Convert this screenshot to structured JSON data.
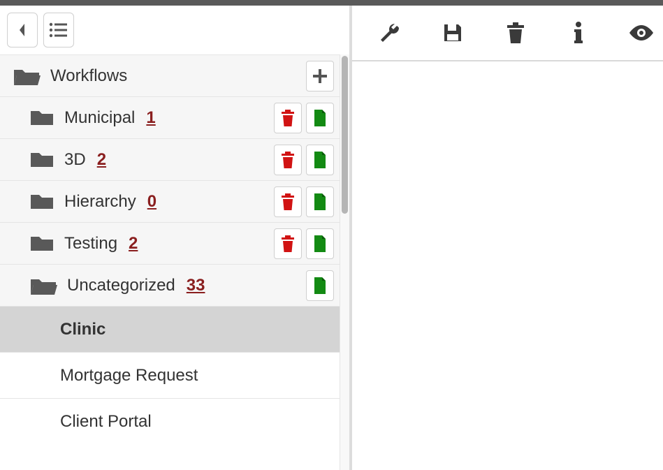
{
  "sidebar": {
    "root_label": "Workflows",
    "categories": [
      {
        "label": "Municipal",
        "count": "1",
        "open": false,
        "can_delete": true
      },
      {
        "label": "3D",
        "count": "2",
        "open": false,
        "can_delete": true
      },
      {
        "label": "Hierarchy",
        "count": "0",
        "open": false,
        "can_delete": true
      },
      {
        "label": "Testing",
        "count": "2",
        "open": false,
        "can_delete": true
      },
      {
        "label": "Uncategorized",
        "count": "33",
        "open": true,
        "can_delete": false
      }
    ],
    "workflows": [
      {
        "label": "Clinic",
        "selected": true
      },
      {
        "label": "Mortgage Request",
        "selected": false
      },
      {
        "label": "Client Portal",
        "selected": false
      }
    ]
  }
}
